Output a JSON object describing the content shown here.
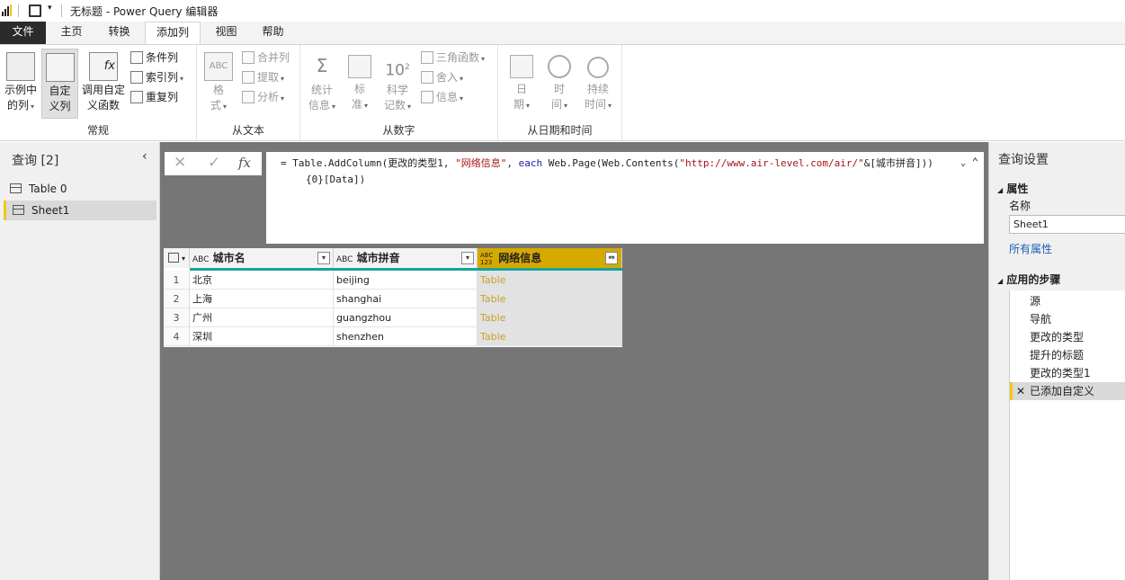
{
  "window": {
    "title": "无标题 - Power Query 编辑器"
  },
  "tabs": [
    "文件",
    "主页",
    "转换",
    "添加列",
    "视图",
    "帮助"
  ],
  "ribbon": {
    "general": {
      "label": "常规",
      "example": [
        "示例中",
        "的列"
      ],
      "custom": [
        "自定",
        "义列"
      ],
      "invoke": [
        "调用自定",
        "义函数"
      ],
      "conditional": "条件列",
      "index": "索引列",
      "duplicate": "重复列"
    },
    "text": {
      "label": "从文本",
      "format": [
        "格",
        "式"
      ],
      "merge": "合并列",
      "extract": "提取",
      "parse": "分析"
    },
    "number": {
      "label": "从数字",
      "stats": [
        "统计",
        "信息"
      ],
      "standard": [
        "标",
        "准"
      ],
      "sci_top": "10",
      "sci_sup": "2",
      "scientific": [
        "科学",
        "记数"
      ],
      "trig": "三角函数",
      "round": "舍入",
      "info": "信息"
    },
    "datetime": {
      "label": "从日期和时间",
      "date": [
        "日",
        "期"
      ],
      "time": [
        "时",
        "间"
      ],
      "duration": [
        "持续",
        "时间"
      ]
    }
  },
  "queries": {
    "header": "查询 [2]",
    "items": [
      "Table 0",
      "Sheet1"
    ]
  },
  "formula": {
    "eq": "=",
    "p1": "Table.AddColumn(更改的类型1, ",
    "s1": "\"网络信息\"",
    "p2": ", ",
    "kw": "each",
    "p3": " Web.Page(Web.Contents(",
    "s2": "\"http://www.air-level.com/air/\"",
    "p4": "&[城市拼音]))",
    "line2": "{0}[Data])"
  },
  "table": {
    "columns": [
      {
        "name": "城市名",
        "type": "ABC"
      },
      {
        "name": "城市拼音",
        "type": "ABC"
      },
      {
        "name": "网络信息",
        "type": "ABC 123"
      }
    ],
    "rows": [
      [
        "1",
        "北京",
        "beijing",
        "Table"
      ],
      [
        "2",
        "上海",
        "shanghai",
        "Table"
      ],
      [
        "3",
        "广州",
        "guangzhou",
        "Table"
      ],
      [
        "4",
        "深圳",
        "shenzhen",
        "Table"
      ]
    ]
  },
  "settings": {
    "title": "查询设置",
    "properties": "属性",
    "name_label": "名称",
    "name_value": "Sheet1",
    "all_props": "所有属性",
    "steps_title": "应用的步骤",
    "steps": [
      "源",
      "导航",
      "更改的类型",
      "提升的标题",
      "更改的类型1",
      "已添加自定义"
    ]
  },
  "colors": {
    "accent": "#f2c811",
    "highlight_col": "#d6a900",
    "teal": "#18a39b"
  }
}
